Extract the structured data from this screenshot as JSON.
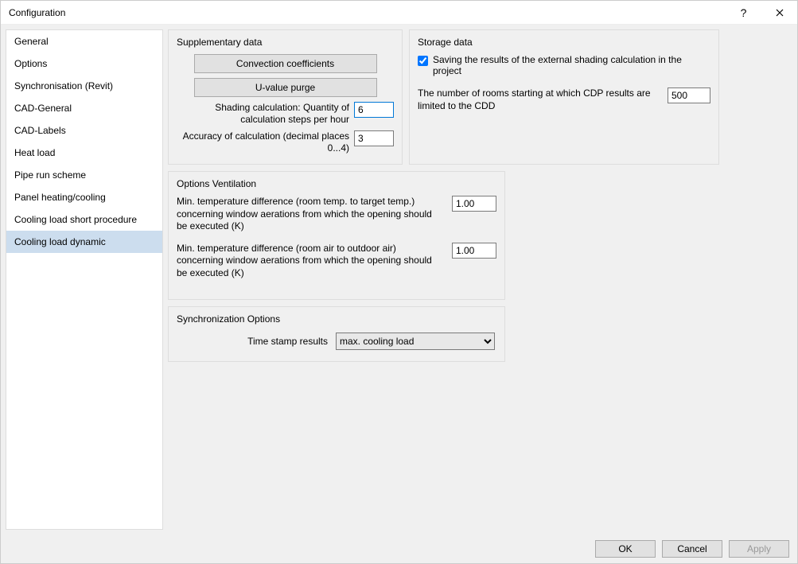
{
  "window": {
    "title": "Configuration"
  },
  "sidebar": {
    "items": [
      {
        "label": "General"
      },
      {
        "label": "Options"
      },
      {
        "label": "Synchronisation (Revit)"
      },
      {
        "label": "CAD-General"
      },
      {
        "label": "CAD-Labels"
      },
      {
        "label": "Heat load"
      },
      {
        "label": "Pipe run scheme"
      },
      {
        "label": "Panel heating/cooling"
      },
      {
        "label": "Cooling load short procedure"
      },
      {
        "label": "Cooling load dynamic"
      }
    ],
    "selected_index": 9
  },
  "supplementary": {
    "title": "Supplementary data",
    "btn_convection": "Convection coefficients",
    "btn_uvalue": "U-value purge",
    "label_quantity": "Shading calculation: Quantity of calculation steps per hour",
    "value_quantity": "6",
    "label_accuracy": "Accuracy of calculation (decimal places 0...4)",
    "value_accuracy": "3"
  },
  "storage": {
    "title": "Storage data",
    "checkbox_label": "Saving the results of the external shading calculation in the project",
    "checkbox_checked": true,
    "label_rooms": "The number of rooms starting at which CDP results are limited to the CDD",
    "value_rooms": "500"
  },
  "ventilation": {
    "title": "Options Ventilation",
    "label_min1": "Min. temperature difference (room temp. to target temp.) concerning window aerations from which the opening should be executed (K)",
    "value_min1": "1.00",
    "label_min2": "Min. temperature difference (room air to outdoor air) concerning window aerations from which the opening should be executed (K)",
    "value_min2": "1.00"
  },
  "sync": {
    "title": "Synchronization Options",
    "label_timestamp": "Time stamp results",
    "value_timestamp": "max. cooling load"
  },
  "footer": {
    "ok": "OK",
    "cancel": "Cancel",
    "apply": "Apply"
  }
}
